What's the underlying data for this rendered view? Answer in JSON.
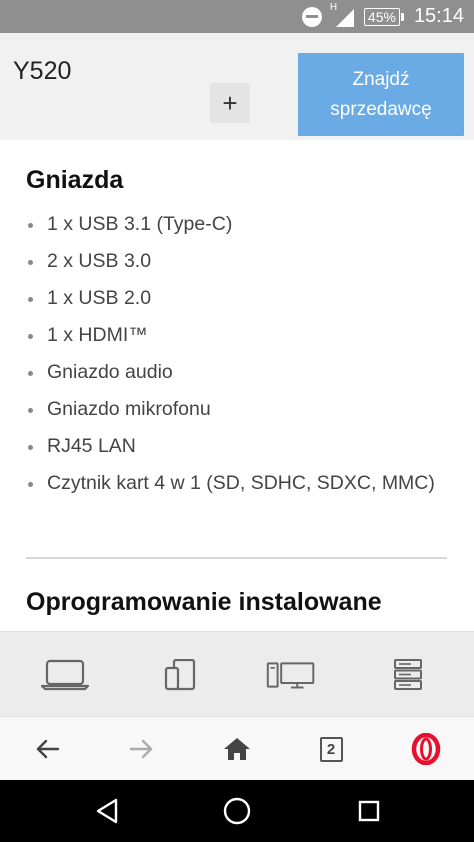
{
  "status_bar": {
    "time": "15:14",
    "battery": "45%",
    "network_label": "H",
    "icons": [
      "do-not-disturb-icon",
      "signal-icon",
      "battery-icon"
    ]
  },
  "header": {
    "model": "Y520",
    "plus_label": "+",
    "find_seller_label": "Znajdź\nsprzedawcę"
  },
  "ports_section": {
    "title": "Gniazda",
    "items": [
      "1 x USB 3.1 (Type-C)",
      "2 x USB 3.0",
      "1 x USB 2.0",
      "1 x HDMI™",
      "Gniazdo audio",
      "Gniazdo mikrofonu",
      "RJ45 LAN",
      "Czytnik kart 4 w 1 (SD, SDHC, SDXC, MMC)"
    ]
  },
  "software_section": {
    "title": "Oprogramowanie instalowane"
  },
  "category_bar": {
    "icons": [
      "laptop-icon",
      "tablet-phone-icon",
      "desktop-monitor-icon",
      "server-icon"
    ]
  },
  "browser_bar": {
    "tab_count": "2",
    "icons": [
      "back-arrow-icon",
      "forward-arrow-icon",
      "home-icon",
      "tabs-icon",
      "opera-icon"
    ]
  },
  "android_nav": {
    "icons": [
      "back-triangle-icon",
      "home-circle-icon",
      "recents-square-icon"
    ]
  },
  "colors": {
    "status_bar": "#8f8f8f",
    "header_bg": "#f1f1f1",
    "accent_button": "#6aabe5",
    "opera_red": "#e8102d"
  }
}
